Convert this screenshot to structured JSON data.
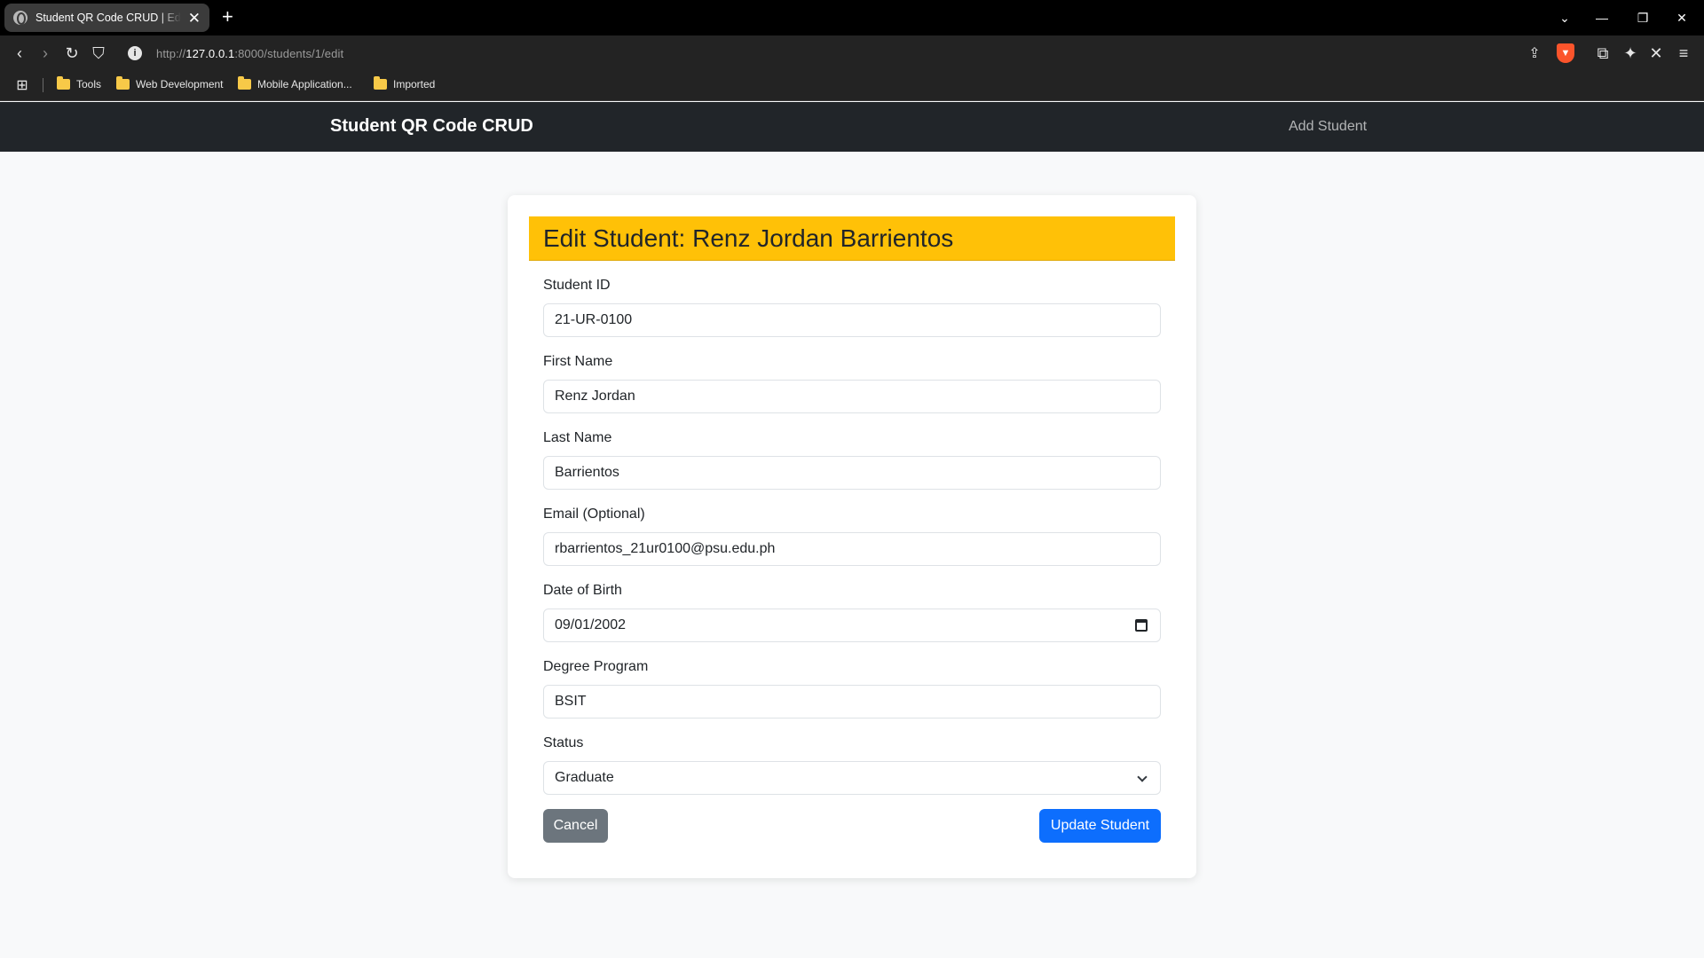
{
  "browser": {
    "tab_title": "Student QR Code CRUD | Edit Student",
    "url_scheme": "http://",
    "url_host": "127.0.0.1",
    "url_path": ":8000/students/1/edit",
    "bookmarks": [
      "Tools",
      "Web Development",
      "Mobile Application...",
      "Imported"
    ]
  },
  "navbar": {
    "brand": "Student QR Code CRUD",
    "add_student": "Add Student"
  },
  "form": {
    "title": "Edit Student: Renz Jordan Barrientos",
    "student_id_label": "Student ID",
    "student_id_value": "21-UR-0100",
    "first_name_label": "First Name",
    "first_name_value": "Renz Jordan",
    "last_name_label": "Last Name",
    "last_name_value": "Barrientos",
    "email_label": "Email (Optional)",
    "email_value": "rbarrientos_21ur0100@psu.edu.ph",
    "dob_label": "Date of Birth",
    "dob_value": "09/01/2002",
    "degree_label": "Degree Program",
    "degree_value": "BSIT",
    "status_label": "Status",
    "status_value": "Graduate",
    "cancel_label": "Cancel",
    "update_label": "Update Student"
  },
  "colors": {
    "header_bg": "#ffc107",
    "navbar_bg": "#212529",
    "primary": "#0d6efd",
    "secondary": "#6c757d"
  }
}
